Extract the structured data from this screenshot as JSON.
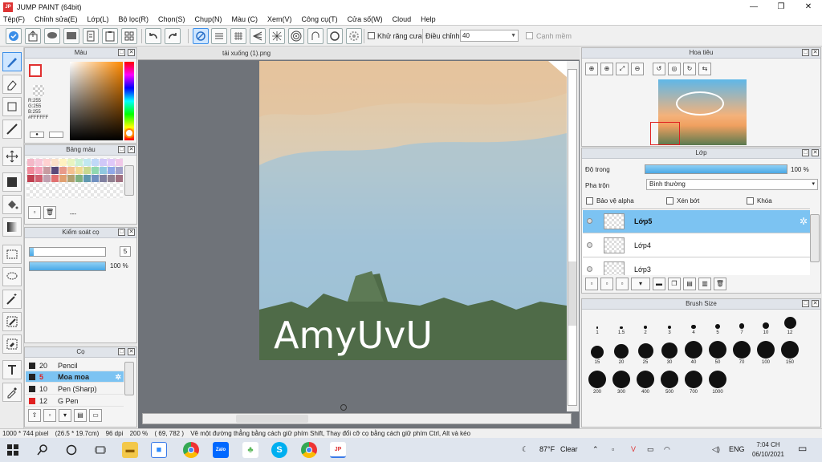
{
  "window": {
    "title": "JUMP PAINT (64bit)",
    "app_icon": "JP"
  },
  "menu": [
    "Tệp(F)",
    "Chỉnh sửa(E)",
    "Lớp(L)",
    "Bộ lọc(R)",
    "Chọn(S)",
    "Chụp(N)",
    "Màu (C)",
    "Xem(V)",
    "Công cụ(T)",
    "Cửa số(W)",
    "Cloud",
    "Help"
  ],
  "toolbar": {
    "antialias_label": "Khử răng cưa",
    "adjust_label": "Điều chỉnh",
    "adjust_value": "40",
    "edge_label": "Cạnh mềm"
  },
  "color_panel": {
    "title": "Màu",
    "r": "R:255",
    "g": "G:255",
    "b": "B:255",
    "hex": "#FFFFFF"
  },
  "palette_panel": {
    "title": "Bảng màu",
    "footer": "---",
    "swatches": [
      "#f4b8c8",
      "#f7c6d8",
      "#ffd1d1",
      "#fbe0c8",
      "#fff2c0",
      "#e8f4c0",
      "#c8f0d4",
      "#c0e8f0",
      "#c0d8f8",
      "#d0c8f8",
      "#e0c8f8",
      "#f0c8e8",
      "#f08a9a",
      "#f4a0b8",
      "#c89aa0",
      "#5a4a7a",
      "#e89a8a",
      "#f4c090",
      "#f0d890",
      "#c8d890",
      "#90d8b0",
      "#90c8e0",
      "#90a8e8",
      "#a0a0c8",
      "#c04050",
      "#d06070",
      "#c0a0b0",
      "#e07070",
      "#e0a070",
      "#b0a070",
      "#80b080",
      "#6098b0",
      "#7090c0",
      "#8080a0",
      "#908090",
      "#a07080"
    ]
  },
  "brush_control": {
    "title": "Kiểm soát cọ",
    "size": "5",
    "opacity": "100 %",
    "size_fraction": 0.05,
    "opacity_fraction": 1.0
  },
  "brush_panel": {
    "title": "Cọ",
    "rows": [
      {
        "size": "20",
        "name": "Pencil",
        "color": "#222222",
        "selected": false
      },
      {
        "size": "5",
        "name": "Moa moa",
        "color": "#222222",
        "selected": true
      },
      {
        "size": "10",
        "name": "Pen (Sharp)",
        "color": "#222222",
        "selected": false
      },
      {
        "size": "12",
        "name": "G Pen",
        "color": "#e02020",
        "selected": false
      }
    ]
  },
  "canvas": {
    "tab": "tải xuống (1).png",
    "signature": "AmyUvU"
  },
  "navigator": {
    "title": "Hoa tiêu"
  },
  "layer_panel": {
    "title": "Lớp",
    "opacity_label": "Độ trong",
    "opacity_value": "100 %",
    "opacity_fraction": 1.0,
    "blend_label": "Pha trộn",
    "blend_value": "Bình thường",
    "protect_alpha": "Bảo vệ alpha",
    "clip": "Xén bớt",
    "lock": "Khóa",
    "layers": [
      "Lớp5",
      "Lớp4",
      "Lớp3"
    ]
  },
  "brush_size_panel": {
    "title": "Brush Size",
    "sizes": [
      "1",
      "1.5",
      "2",
      "3",
      "4",
      "5",
      "7",
      "10",
      "12",
      "15",
      "20",
      "25",
      "30",
      "40",
      "50",
      "70",
      "100",
      "150",
      "200",
      "300",
      "400",
      "500",
      "700",
      "1000"
    ]
  },
  "status": {
    "size": "1000 * 744 pixel",
    "cm": "(26.5 * 19.7cm)",
    "dpi": "96 dpi",
    "zoom": "200 %",
    "coords": "( 69, 782 )",
    "hint": "Vẽ một đường thẳng bằng cách giữ phím Shift, Thay đổi cỡ cọ bằng cách giữ phím Ctrl, Alt và kéo"
  },
  "taskbar": {
    "weather_temp": "87°F",
    "weather_text": "Clear",
    "lang": "ENG",
    "time": "7:04 CH",
    "date": "06/10/2021",
    "zalo": "Zalo"
  }
}
